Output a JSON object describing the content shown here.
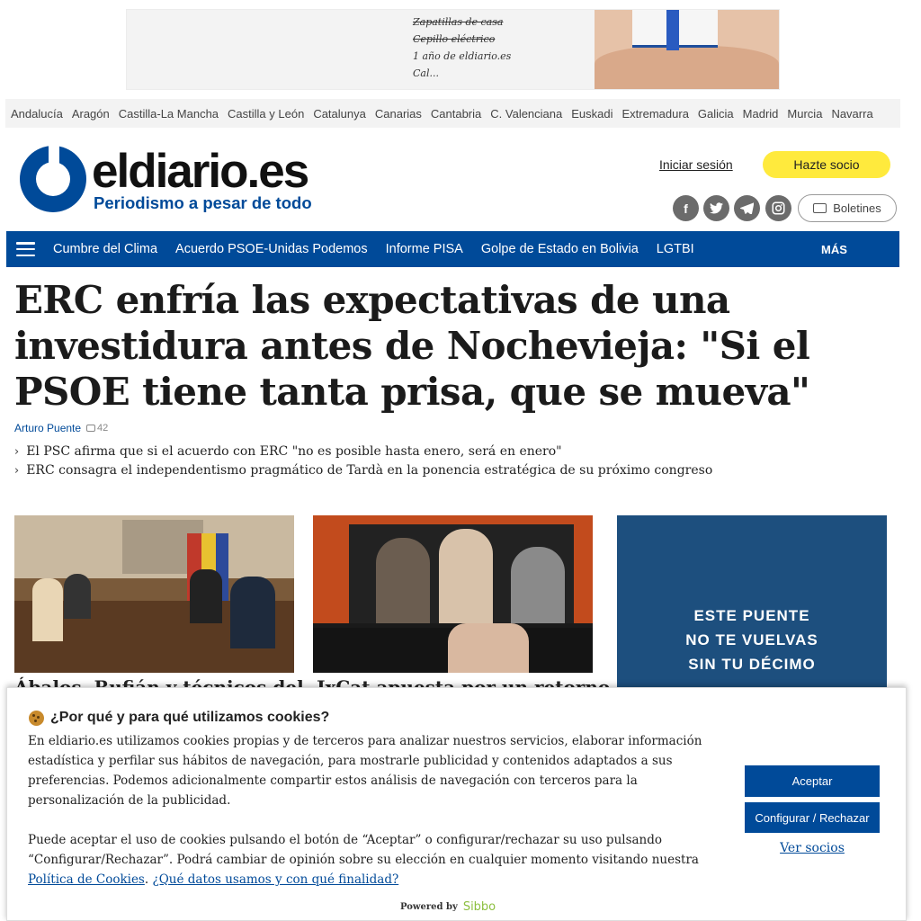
{
  "ad_top": {
    "notes": [
      "Zapatillas de casa",
      "Cepillo eléctrico",
      "1 año de eldiario.es",
      "Cal..."
    ]
  },
  "regions": [
    "Andalucía",
    "Aragón",
    "Castilla-La Mancha",
    "Castilla y León",
    "Catalunya",
    "Canarias",
    "Cantabria",
    "C. Valenciana",
    "Euskadi",
    "Extremadura",
    "Galicia",
    "Madrid",
    "Murcia",
    "Navarra"
  ],
  "header": {
    "logo": "eldiario.es",
    "tagline": "Periodismo a pesar de todo",
    "login": "Iniciar sesión",
    "partner": "Hazte socio",
    "newsletter": "Boletines",
    "social": [
      "facebook-icon",
      "twitter-icon",
      "telegram-icon",
      "instagram-icon"
    ]
  },
  "nav": {
    "items": [
      "Cumbre del Clima",
      "Acuerdo PSOE-Unidas Podemos",
      "Informe PISA",
      "Golpe de Estado en Bolivia",
      "LGTBI"
    ],
    "more": "MÁS"
  },
  "article": {
    "headline": "ERC enfría las expectativas de una investidura antes de Nochevieja: \"Si el PSOE tiene tanta prisa, que se mueva\"",
    "author": "Arturo Puente",
    "comments": "42",
    "related": [
      "El PSC afirma que si el acuerdo con ERC \"no es posible hasta enero, será en enero\"",
      "ERC consagra el independentismo pragmático de Tardà en la ponencia estratégica de su próximo congreso"
    ]
  },
  "teasers": [
    "Ábalos, Rufián y técnicos del",
    "JxCat apuesta por un retorno"
  ],
  "ad_side": {
    "lines": [
      "ESTE PUENTE",
      "NO TE VUELVAS",
      "SIN TU DÉCIMO"
    ]
  },
  "cookie": {
    "title": "¿Por qué y para qué utilizamos cookies?",
    "p1": "En eldiario.es utilizamos cookies propias y de terceros para analizar nuestros servicios, elaborar información estadística y perfilar sus hábitos de navegación, para mostrarle publicidad y contenidos adaptados a sus preferencias. Podemos adicionalmente compartir estos análisis de navegación con terceros para la personalización de la publicidad.",
    "p2_text": "Puede aceptar el uso de cookies pulsando el botón de “Aceptar” o configurar/rechazar su uso pulsando “Configurar/Rechazar”. Podrá cambiar de opinión sobre su elección en cualquier momento visitando nuestra ",
    "p2_link1": "Política de Cookies",
    "p2_sep": ". ",
    "p2_link2": "¿Qué datos usamos y con qué finalidad?",
    "accept": "Aceptar",
    "configure": "Configurar / Rechazar",
    "partners": "Ver socios",
    "powered": "Powered by",
    "powered_brand": "Sibbo"
  }
}
